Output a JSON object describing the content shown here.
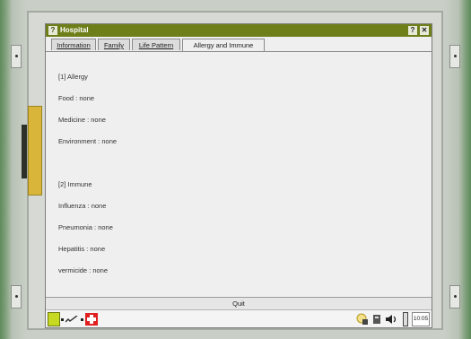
{
  "window": {
    "title": "Hospital"
  },
  "tabs": [
    {
      "label": "Information"
    },
    {
      "label": "Family"
    },
    {
      "label": "Life Pattern"
    },
    {
      "label": "Allergy and Immune"
    }
  ],
  "allergy": {
    "heading": "[1] Allergy",
    "food": "Food : none",
    "medicine": "Medicine : none",
    "environment": "Environment : none"
  },
  "immune": {
    "heading": "[2] Immune",
    "influenza": "Influenza : none",
    "pneumonia": "Pneumonia : none",
    "hepatitis": "Hepatitis : none",
    "vermicide": "vermicide : none"
  },
  "quit_label": "Quit",
  "taskbar": {
    "clock": "10:05"
  },
  "colors": {
    "titlebar": "#6e7f1a",
    "start_button": "#c7d920",
    "medical_cross": "#e02020"
  }
}
